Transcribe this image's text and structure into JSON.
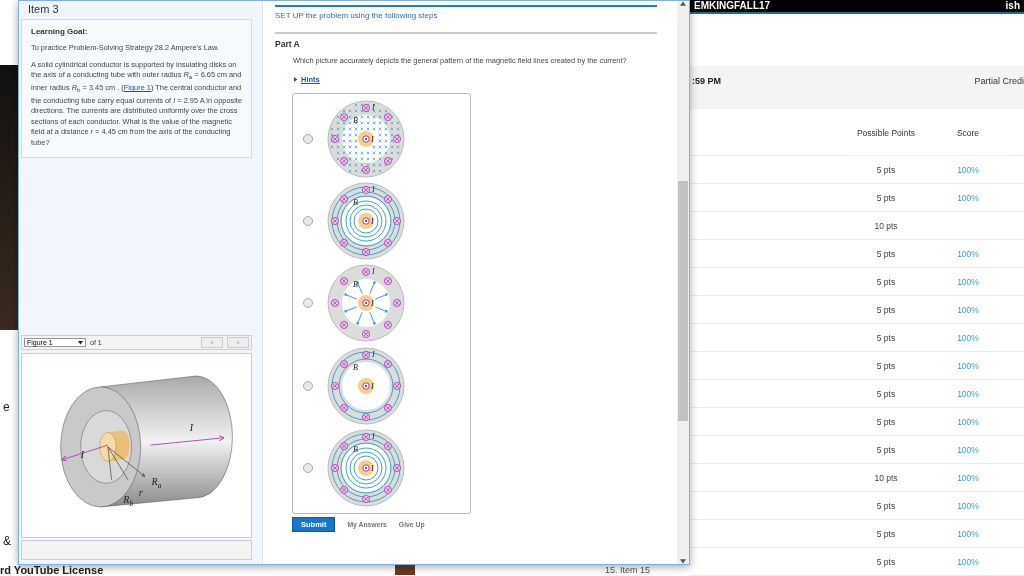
{
  "background": {
    "account": "EMKINGFALL17",
    "account_right": "ish",
    "due_time": ":59 PM",
    "credit_note": "Partial Credi",
    "columns": [
      "Possible Points",
      "Score"
    ],
    "rows": [
      {
        "points": "5 pts",
        "score": "100%"
      },
      {
        "points": "5 pts",
        "score": "100%"
      },
      {
        "points": "10 pts"
      },
      {
        "points": "5 pts",
        "score": "100%"
      },
      {
        "points": "5 pts",
        "score": "100%"
      },
      {
        "points": "5 pts",
        "score": "100%"
      },
      {
        "points": "5 pts",
        "score": "100%"
      },
      {
        "points": "5 pts",
        "score": "100%"
      },
      {
        "points": "5 pts",
        "score": "100%"
      },
      {
        "points": "5 pts",
        "score": "100%"
      },
      {
        "points": "5 pts",
        "score": "100%"
      },
      {
        "points": "10 pts",
        "score": "100%"
      },
      {
        "points": "5 pts",
        "score": "100%"
      },
      {
        "points": "5 pts",
        "score": "100%"
      },
      {
        "points": "5 pts",
        "score": "100%"
      }
    ],
    "fragments": [
      "e",
      "&"
    ],
    "license": "rd YouTube License",
    "next_item": "15. Item 15"
  },
  "item": {
    "title": "Item 3",
    "learning_goal": {
      "heading": "Learning Goal:",
      "goal": "To practice Problem-Solving Strategy 28.2 Ampere's Law.",
      "text_before": "A solid cylindrical conductor is supported by insulating disks on the axis of a conducting tube with outer radius *R*$_{a}$ = 6.65 cm and inner radius *R*$_{b}$ = 3.45 cm . (",
      "link": "Figure 1",
      "text_after": ") The central conductor and the conducting tube carry equal currents of *I* = 2.95 A in opposite directions. The currents are distributed uniformly over the cross sections of each conductor. What is the value of the magnetic field at a distance *r* = 4.45 cm from the axis of the conducting tube?"
    },
    "figure": {
      "selector": "Figure 1",
      "count": "of 1",
      "prev": "‹",
      "next": "›",
      "labels": [
        {
          "text": "I"
        },
        {
          "text": "I"
        },
        {
          "text": "R",
          "sub": "a"
        },
        {
          "text": "R",
          "sub": "b"
        },
        {
          "text": "r"
        }
      ]
    }
  },
  "problem": {
    "instruction": "SET UP the problem using the following steps",
    "part": "Part A",
    "question": "Which picture accurately depicts the general pattern of the magnetic field lines created by the current?",
    "hints": "Hints",
    "options": [
      {
        "kind": "uniform",
        "selected": false,
        "labels": [
          "I",
          "B",
          "I"
        ]
      },
      {
        "kind": "concentric",
        "selected": false,
        "labels": [
          "I",
          "B",
          "I"
        ]
      },
      {
        "kind": "radial",
        "selected": false,
        "labels": [
          "I",
          "B",
          "I"
        ]
      },
      {
        "kind": "outer",
        "selected": false,
        "labels": [
          "I",
          "B",
          "I"
        ]
      },
      {
        "kind": "concentric",
        "selected": false,
        "labels": [
          "I",
          "B",
          "I"
        ]
      }
    ],
    "buttons": {
      "submit": "Submit",
      "answers": "My Answers",
      "give_up": "Give Up"
    }
  }
}
